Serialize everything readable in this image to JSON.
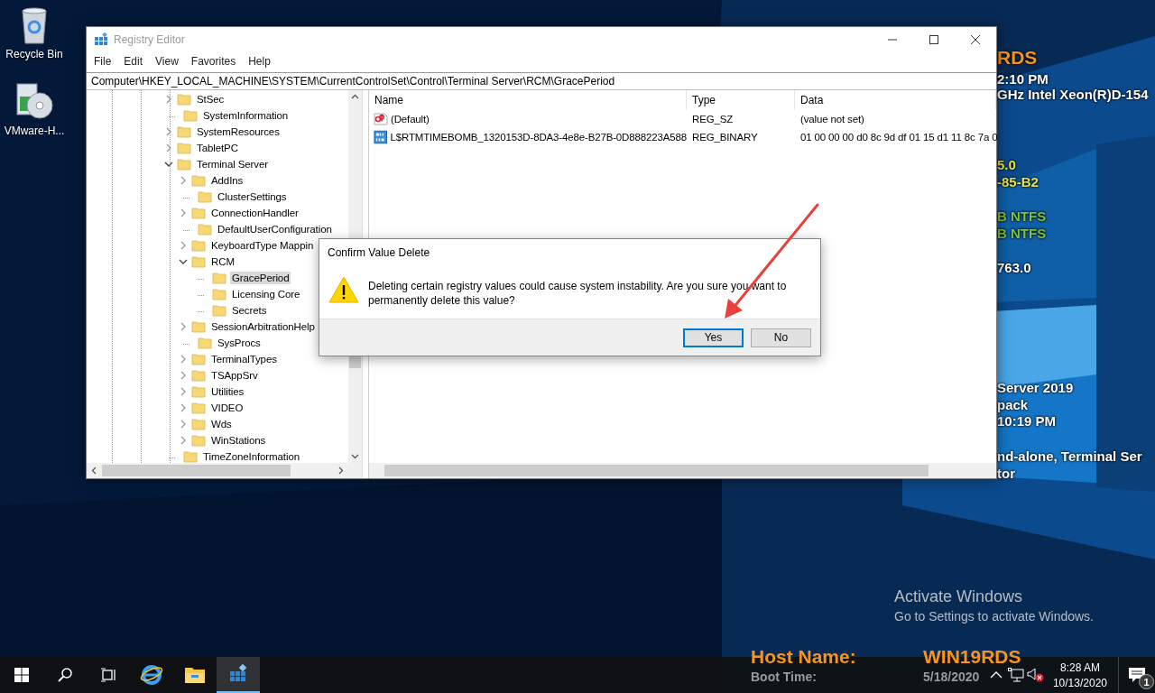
{
  "desktop": {
    "icons": [
      {
        "kind": "recycle-bin",
        "label": "Recycle Bin"
      },
      {
        "kind": "installer",
        "label": "VMware-H..."
      }
    ],
    "info_lines": [
      {
        "kind": "heading",
        "text": "RDS",
        "color": "#f7941d"
      },
      {
        "kind": "line",
        "text": "2:10 PM",
        "color": "#ffffff"
      },
      {
        "kind": "line",
        "text": "GHz Intel Xeon(R)D-154",
        "color": "#ffffff"
      },
      {
        "kind": "line",
        "text": "5.0",
        "color": "#e8e34a"
      },
      {
        "kind": "line",
        "text": "-85-B2",
        "color": "#e8e34a"
      },
      {
        "kind": "line",
        "text": "B NTFS",
        "color": "#7ec242"
      },
      {
        "kind": "line",
        "text": "B NTFS",
        "color": "#7ec242"
      },
      {
        "kind": "line",
        "text": "763.0",
        "color": "#ffffff"
      },
      {
        "kind": "line",
        "text": "Server 2019",
        "color": "#ffffff"
      },
      {
        "kind": "line",
        "text": "pack",
        "color": "#ffffff"
      },
      {
        "kind": "line",
        "text": "10:19 PM",
        "color": "#ffffff"
      },
      {
        "kind": "line",
        "text": "nd-alone, Terminal Ser",
        "color": "#ffffff"
      },
      {
        "kind": "line",
        "text": "tor",
        "color": "#ffffff"
      }
    ],
    "host_info": [
      {
        "kind": "heading",
        "label": "Host Name:",
        "value": "WIN19RDS",
        "color": "#f7941d"
      },
      {
        "kind": "line",
        "label": "Boot Time:",
        "value": "5/18/2020",
        "color": "#9a9a9a"
      }
    ],
    "activation_notice": {
      "title": "Activate Windows",
      "subtitle": "Go to Settings to activate Windows."
    }
  },
  "window": {
    "title": "Registry Editor",
    "menu": [
      "File",
      "Edit",
      "View",
      "Favorites",
      "Help"
    ],
    "address": "Computer\\HKEY_LOCAL_MACHINE\\SYSTEM\\CurrentControlSet\\Control\\Terminal Server\\RCM\\GracePeriod",
    "tree": [
      {
        "label": "StSec",
        "kind": "node",
        "expanded": false,
        "selected": false
      },
      {
        "label": "SystemInformation",
        "kind": "leaf",
        "selected": false
      },
      {
        "label": "SystemResources",
        "kind": "node",
        "expanded": false,
        "selected": false
      },
      {
        "label": "TabletPC",
        "kind": "node",
        "expanded": false,
        "selected": false
      },
      {
        "label": "Terminal Server",
        "kind": "node",
        "expanded": true,
        "selected": false,
        "children": [
          {
            "label": "AddIns",
            "kind": "node",
            "expanded": false,
            "selected": false
          },
          {
            "label": "ClusterSettings",
            "kind": "leaf",
            "selected": false
          },
          {
            "label": "ConnectionHandler",
            "kind": "node",
            "expanded": false,
            "selected": false
          },
          {
            "label": "DefaultUserConfiguration",
            "kind": "leaf",
            "selected": false
          },
          {
            "label": "KeyboardType Mappin",
            "kind": "node",
            "expanded": false,
            "selected": false
          },
          {
            "label": "RCM",
            "kind": "node",
            "expanded": true,
            "selected": false,
            "children": [
              {
                "label": "GracePeriod",
                "kind": "leaf",
                "selected": true
              },
              {
                "label": "Licensing Core",
                "kind": "leaf",
                "selected": false
              },
              {
                "label": "Secrets",
                "kind": "leaf",
                "selected": false
              }
            ]
          },
          {
            "label": "SessionArbitrationHelp",
            "kind": "node",
            "expanded": false,
            "selected": false
          },
          {
            "label": "SysProcs",
            "kind": "leaf",
            "selected": false
          },
          {
            "label": "TerminalTypes",
            "kind": "node",
            "expanded": false,
            "selected": false
          },
          {
            "label": "TSAppSrv",
            "kind": "node",
            "expanded": false,
            "selected": false
          },
          {
            "label": "Utilities",
            "kind": "node",
            "expanded": false,
            "selected": false
          },
          {
            "label": "VIDEO",
            "kind": "node",
            "expanded": false,
            "selected": false
          },
          {
            "label": "Wds",
            "kind": "node",
            "expanded": false,
            "selected": false
          },
          {
            "label": "WinStations",
            "kind": "node",
            "expanded": false,
            "selected": false
          }
        ]
      },
      {
        "label": "TimeZoneInformation",
        "kind": "leaf",
        "selected": false
      }
    ],
    "values": {
      "columns": [
        "Name",
        "Type",
        "Data"
      ],
      "rows": [
        {
          "kind": "string",
          "name": "(Default)",
          "type": "REG_SZ",
          "data": "(value not set)"
        },
        {
          "kind": "binary",
          "name": "L$RTMTIMEBOMB_1320153D-8DA3-4e8e-B27B-0D888223A588",
          "type": "REG_BINARY",
          "data": "01 00 00 00 d0 8c 9d df 01 15 d1 11 8c 7a 0"
        }
      ]
    }
  },
  "dialog": {
    "title": "Confirm Value Delete",
    "message": "Deleting certain registry values could cause system instability. Are you sure you want to permanently delete this value?",
    "buttons": [
      {
        "label": "Yes",
        "default": true
      },
      {
        "label": "No",
        "default": false
      }
    ]
  },
  "taskbar": {
    "apps": [
      {
        "kind": "start",
        "active": false
      },
      {
        "kind": "search",
        "active": false
      },
      {
        "kind": "task-view",
        "active": false
      },
      {
        "kind": "browser",
        "active": false
      },
      {
        "kind": "file-explorer",
        "active": false
      },
      {
        "kind": "registry-editor",
        "active": true
      }
    ],
    "clock": {
      "time": "8:28 AM",
      "date": "10/13/2020"
    },
    "notification_count": "1"
  }
}
